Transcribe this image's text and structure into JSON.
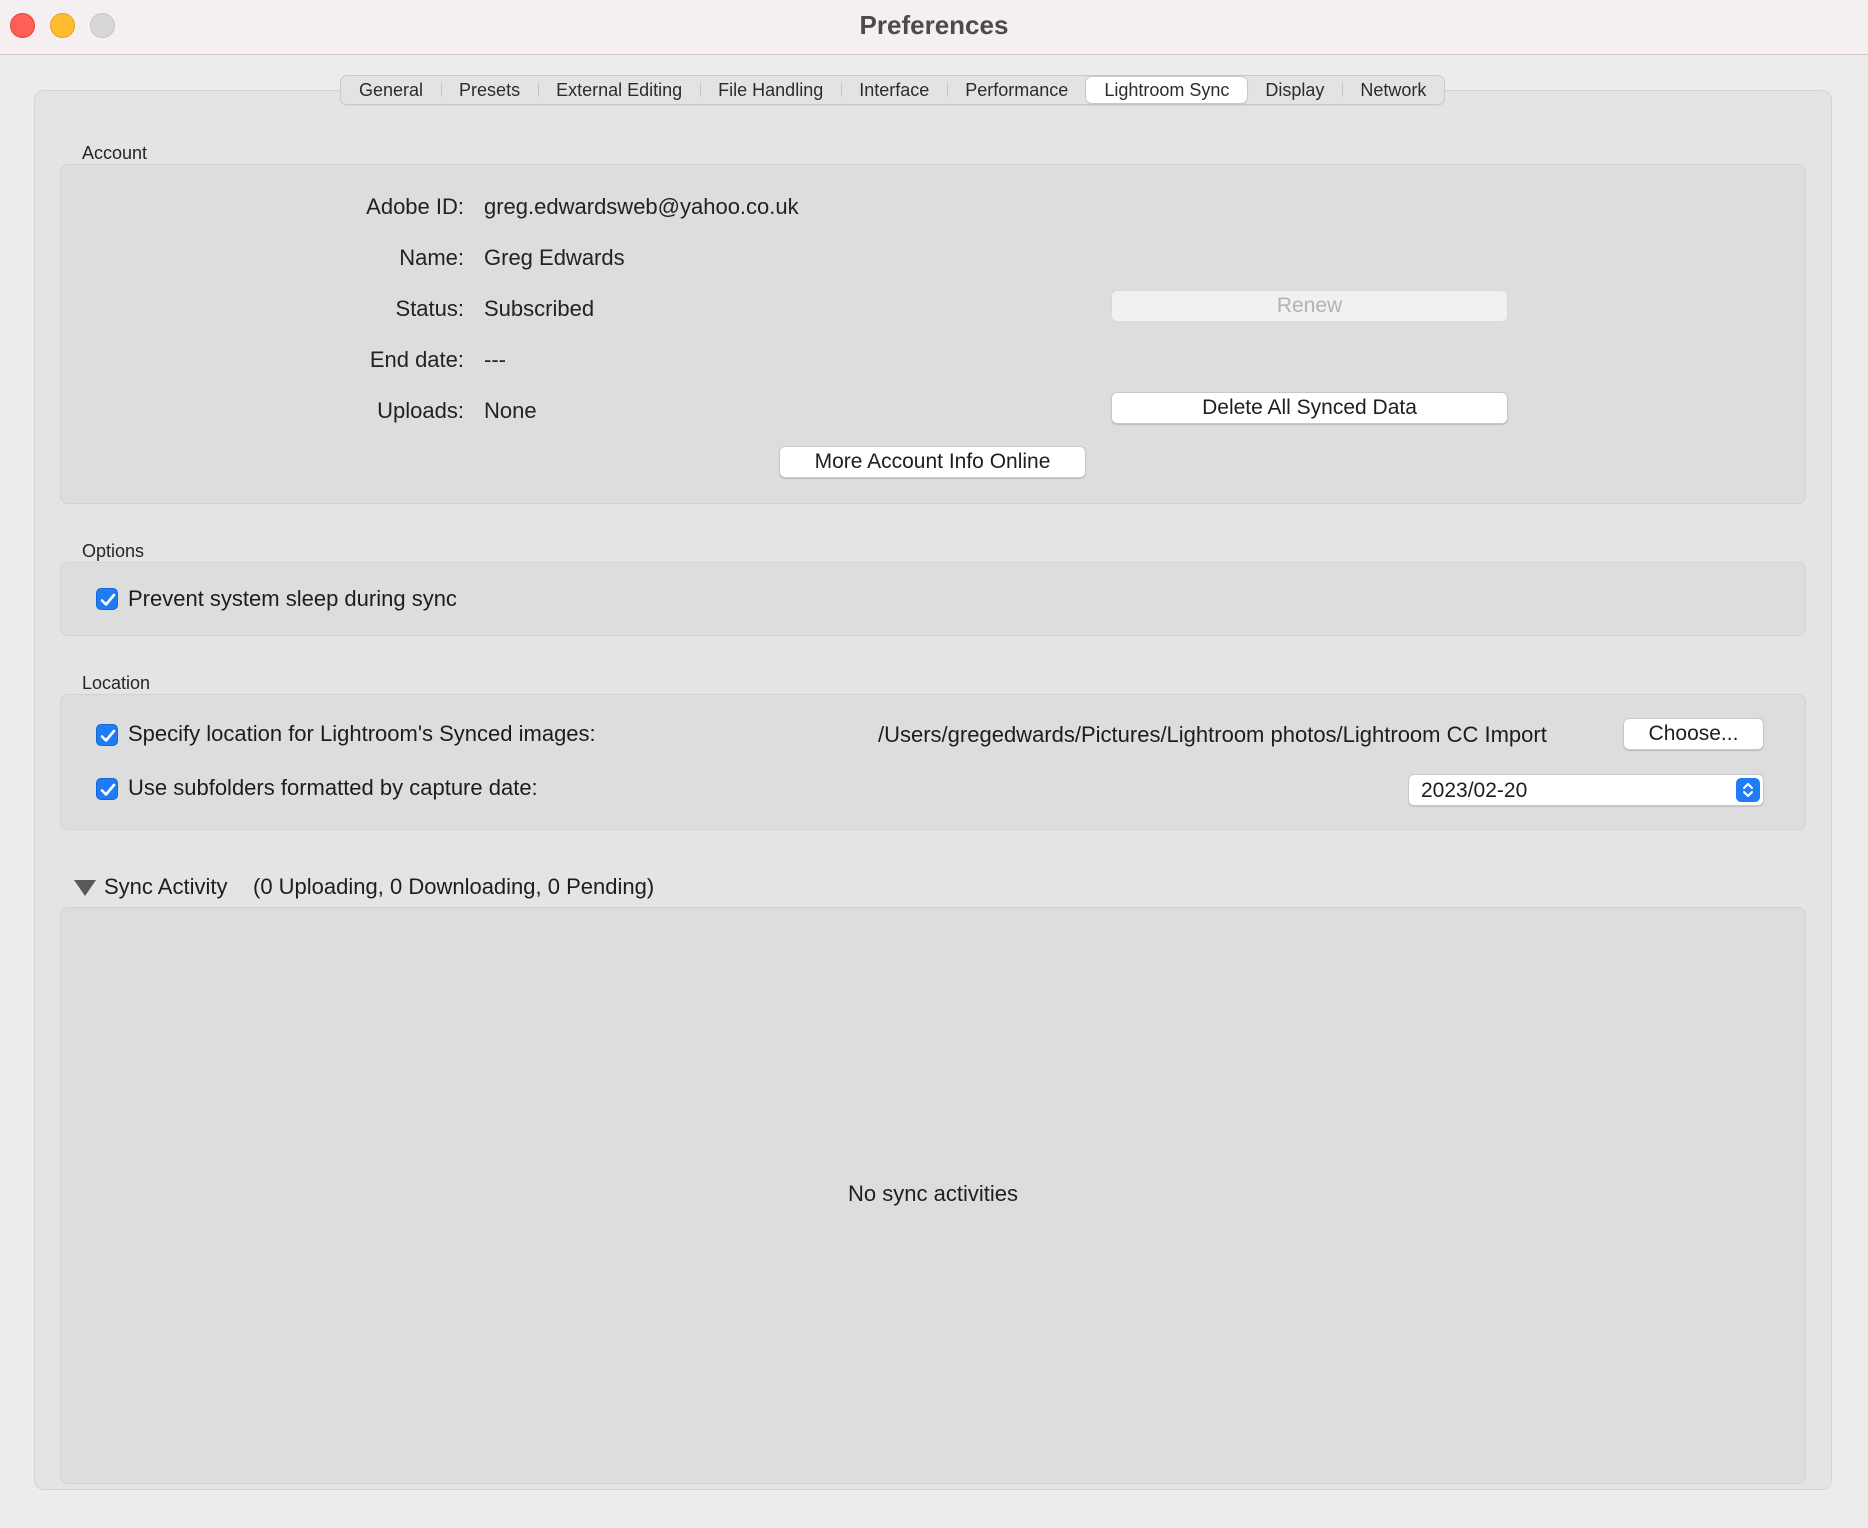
{
  "window": {
    "title": "Preferences"
  },
  "tabs": [
    {
      "label": "General"
    },
    {
      "label": "Presets"
    },
    {
      "label": "External Editing"
    },
    {
      "label": "File Handling"
    },
    {
      "label": "Interface"
    },
    {
      "label": "Performance"
    },
    {
      "label": "Lightroom Sync",
      "active": true
    },
    {
      "label": "Display"
    },
    {
      "label": "Network"
    }
  ],
  "account": {
    "section_label": "Account",
    "adobe_id_label": "Adobe ID:",
    "adobe_id": "greg.edwardsweb@yahoo.co.uk",
    "name_label": "Name:",
    "name": "Greg Edwards",
    "status_label": "Status:",
    "status": "Subscribed",
    "end_date_label": "End date:",
    "end_date": "---",
    "uploads_label": "Uploads:",
    "uploads": "None",
    "renew_button": "Renew",
    "delete_button": "Delete All Synced Data",
    "more_info_button": "More Account Info Online"
  },
  "options": {
    "section_label": "Options",
    "prevent_sleep_label": "Prevent system sleep during sync",
    "prevent_sleep_checked": true
  },
  "location": {
    "section_label": "Location",
    "specify_label": "Specify location for Lightroom's Synced images:",
    "specify_checked": true,
    "path": "/Users/gregedwards/Pictures/Lightroom photos/Lightroom CC Import",
    "choose_button": "Choose...",
    "subfolders_label": "Use subfolders formatted by capture date:",
    "subfolders_checked": true,
    "date_format": "2023/02-20"
  },
  "sync_activity": {
    "header": "Sync Activity",
    "counts": "(0 Uploading, 0 Downloading, 0 Pending)",
    "empty_message": "No sync activities"
  },
  "colors": {
    "accent": "#1f7cf4",
    "close": "#fe5f57",
    "minimize": "#febc2e"
  }
}
